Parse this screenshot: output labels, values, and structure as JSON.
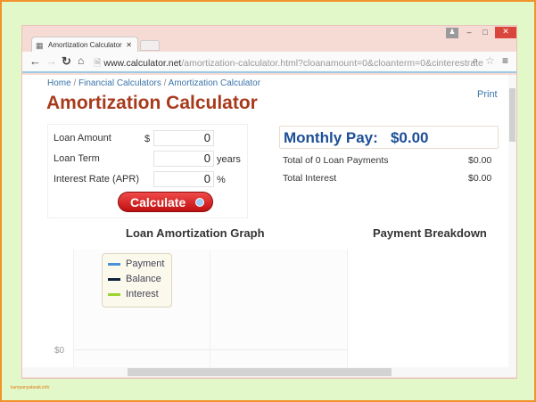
{
  "browser": {
    "tab_title": "Amortization Calculator",
    "url_domain": "www.calculator.net",
    "url_path": "/amortization-calculator.html?cloanamount=0&cloanterm=0&cinterestrate"
  },
  "breadcrumb": [
    "Home",
    "Financial Calculators",
    "Amortization Calculator"
  ],
  "page": {
    "title": "Amortization Calculator",
    "print": "Print"
  },
  "form": {
    "loan_amount_label": "Loan Amount",
    "currency": "$",
    "loan_amount": "0",
    "loan_term_label": "Loan Term",
    "loan_term": "0",
    "years": "years",
    "rate_label": "Interest Rate (APR)",
    "rate": "0",
    "percent": "%",
    "calculate": "Calculate"
  },
  "results": {
    "monthly_label": "Monthly Pay:",
    "monthly_value": "$0.00",
    "total_payments_label": "Total of 0 Loan Payments",
    "total_payments_value": "$0.00",
    "total_interest_label": "Total Interest",
    "total_interest_value": "$0.00"
  },
  "graph": {
    "title": "Loan Amortization Graph",
    "y_tick": "$0",
    "legend": [
      {
        "label": "Payment",
        "color": "#4a90d9"
      },
      {
        "label": "Balance",
        "color": "#0d1f3a"
      },
      {
        "label": "Interest",
        "color": "#9ad430"
      }
    ]
  },
  "breakdown": {
    "title": "Payment Breakdown"
  },
  "watermark": "kampanyabeak.info"
}
